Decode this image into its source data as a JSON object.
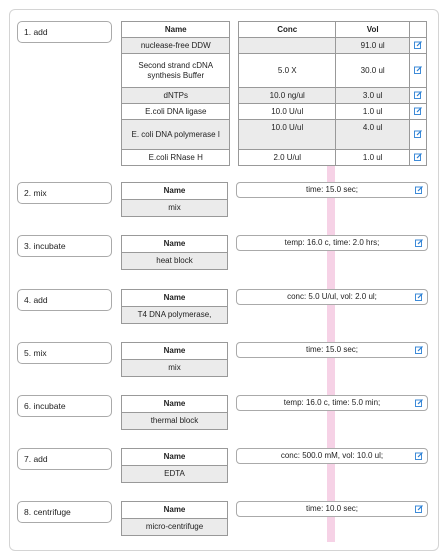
{
  "steps": [
    {
      "label": "1. add",
      "headers": [
        "Name",
        "Conc",
        "Vol"
      ],
      "rows": [
        {
          "name": "nuclease-free DDW",
          "conc": "",
          "vol": "91.0 ul"
        },
        {
          "name": "Second strand cDNA synthesis Buffer",
          "conc": "5.0 X",
          "vol": "30.0 ul"
        },
        {
          "name": "dNTPs",
          "conc": "10.0 ng/ul",
          "vol": "3.0 ul"
        },
        {
          "name": "E.coli DNA ligase",
          "conc": "10.0 U/ul",
          "vol": "1.0 ul"
        },
        {
          "name": "E. coli DNA polymerase I",
          "conc": "10.0 U/ul",
          "vol": "4.0 ul"
        },
        {
          "name": "E.coli RNase H",
          "conc": "2.0 U/ul",
          "vol": "1.0 ul"
        }
      ]
    },
    {
      "label": "2. mix",
      "name_header": "Name",
      "name": "mix",
      "params": "time: 15.0 sec;"
    },
    {
      "label": "3. incubate",
      "name_header": "Name",
      "name": "heat block",
      "params": "temp: 16.0 c, time: 2.0 hrs;"
    },
    {
      "label": "4. add",
      "name_header": "Name",
      "name": "T4 DNA polymerase,",
      "params": "conc: 5.0 U/ul, vol: 2.0 ul;"
    },
    {
      "label": "5. mix",
      "name_header": "Name",
      "name": "mix",
      "params": "time: 15.0 sec;"
    },
    {
      "label": "6. incubate",
      "name_header": "Name",
      "name": "thermal block",
      "params": "temp: 16.0 c, time: 5.0 min;"
    },
    {
      "label": "7. add",
      "name_header": "Name",
      "name": "EDTA",
      "params": "conc: 500.0 mM, vol: 10.0 ul;"
    },
    {
      "label": "8. centrifuge",
      "name_header": "Name",
      "name": "micro-centrifuge",
      "params": "time: 10.0 sec;"
    }
  ],
  "icons": {
    "edit": "edit-icon",
    "accent": "#2a7fd4"
  }
}
